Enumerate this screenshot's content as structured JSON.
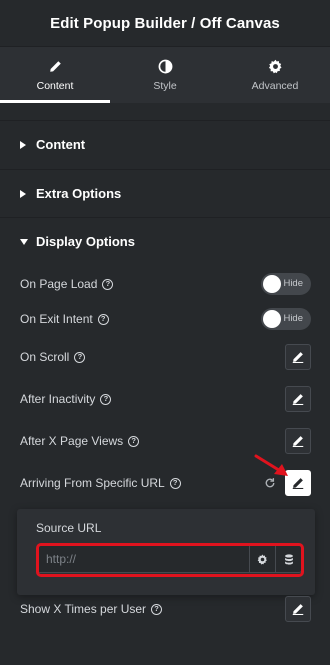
{
  "header": {
    "title": "Edit Popup Builder / Off Canvas"
  },
  "tabs": [
    {
      "label": "Content",
      "icon": "pencil-icon"
    },
    {
      "label": "Style",
      "icon": "contrast-icon"
    },
    {
      "label": "Advanced",
      "icon": "gear-icon"
    }
  ],
  "sections": {
    "content": "Content",
    "extra": "Extra Options",
    "display": "Display Options"
  },
  "display_options": {
    "on_page_load": {
      "label": "On Page Load",
      "toggle": "Hide"
    },
    "on_exit_intent": {
      "label": "On Exit Intent",
      "toggle": "Hide"
    },
    "on_scroll": {
      "label": "On Scroll"
    },
    "after_inactivity": {
      "label": "After Inactivity"
    },
    "after_page_views": {
      "label": "After X Page Views"
    },
    "arriving_url": {
      "label": "Arriving From Specific URL"
    },
    "show_times": {
      "label": "Show X Times per User"
    }
  },
  "popover": {
    "title": "Source URL",
    "placeholder": "http://"
  },
  "colors": {
    "background": "#26292c",
    "tabs_background": "#2d3034",
    "highlight": "#e0131e"
  }
}
